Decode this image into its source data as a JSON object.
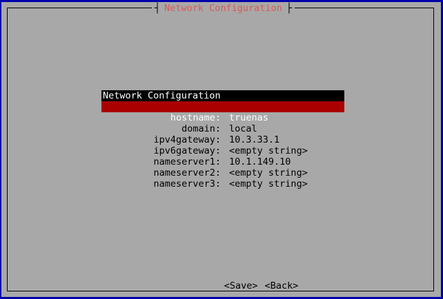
{
  "dialog": {
    "title": "Network Configuration"
  },
  "menu": {
    "header": "Network Configuration",
    "items": [
      {
        "key": "hostname",
        "value": "truenas",
        "selected": true
      },
      {
        "key": "domain",
        "value": "local",
        "selected": false
      },
      {
        "key": "ipv4gateway",
        "value": "10.3.33.1",
        "selected": false
      },
      {
        "key": "ipv6gateway",
        "value": "<empty string>",
        "selected": false
      },
      {
        "key": "nameserver1",
        "value": "10.1.149.10",
        "selected": false
      },
      {
        "key": "nameserver2",
        "value": "<empty string>",
        "selected": false
      },
      {
        "key": "nameserver3",
        "value": "<empty string>",
        "selected": false
      }
    ]
  },
  "buttons": {
    "save_label": "<Save>",
    "back_label": "<Back>"
  },
  "colors": {
    "background": "#0000aa",
    "dialog": "#a8a8a8",
    "title_text": "#d85a5a",
    "selection": "#aa0000",
    "header": "#000000"
  }
}
